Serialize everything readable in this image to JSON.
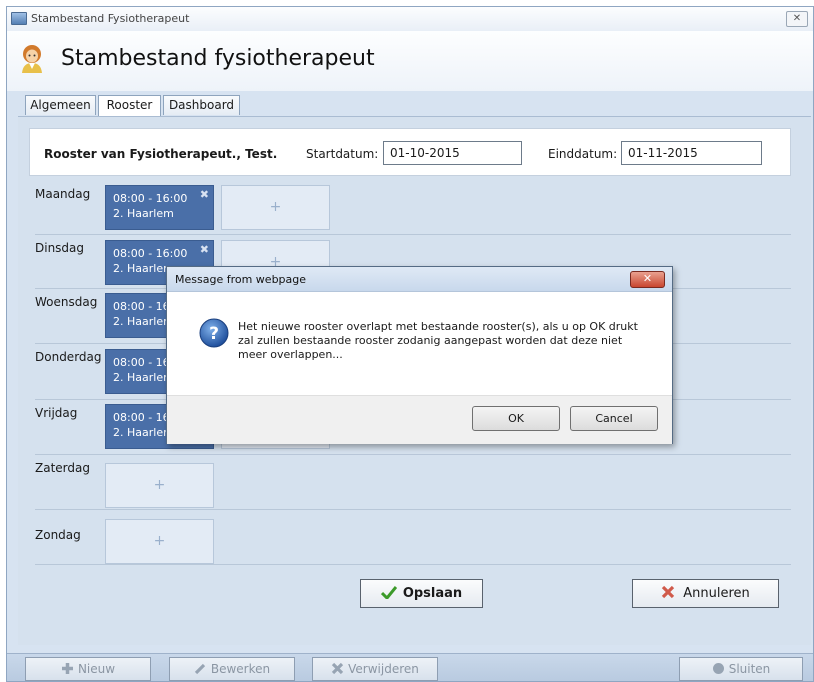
{
  "window": {
    "title": "Stambestand Fysiotherapeut",
    "close_label": "✕"
  },
  "header": {
    "title": "Stambestand fysiotherapeut"
  },
  "tabs": [
    {
      "label": "Algemeen"
    },
    {
      "label": "Rooster"
    },
    {
      "label": "Dashboard"
    }
  ],
  "rooster": {
    "heading": "Rooster van Fysiotherapeut., Test.",
    "start_label": "Startdatum:",
    "start_value": "01-10-2015",
    "end_label": "Einddatum:",
    "end_value": "01-11-2015"
  },
  "days": [
    {
      "name": "Maandag",
      "slot_time": "08:00 - 16:00",
      "slot_location": "2. Haarlem"
    },
    {
      "name": "Dinsdag",
      "slot_time": "08:00 - 16:00",
      "slot_location": "2. Haarlem"
    },
    {
      "name": "Woensdag",
      "slot_time": "08:00 - 16:00",
      "slot_location": "2. Haarlem"
    },
    {
      "name": "Donderdag",
      "slot_time": "08:00 - 16:00",
      "slot_location": "2. Haarlem"
    },
    {
      "name": "Vrijdag",
      "slot_time": "08:00 - 16:00",
      "slot_location": "2. Haarlem"
    },
    {
      "name": "Zaterdag"
    },
    {
      "name": "Zondag"
    }
  ],
  "add_slot_symbol": "+",
  "remove_slot_symbol": "✖",
  "actions": {
    "save_label": "Opslaan",
    "cancel_label": "Annuleren"
  },
  "toolbar": {
    "new_label": "Nieuw",
    "edit_label": "Bewerken",
    "delete_label": "Verwijderen",
    "close_label": "Sluiten"
  },
  "dialog": {
    "title": "Message from webpage",
    "message": "Het nieuwe rooster overlapt met bestaande rooster(s), als u op OK drukt zal zullen bestaande rooster zodanig aangepast worden dat deze niet meer overlappen...",
    "ok_label": "OK",
    "cancel_label": "Cancel",
    "close_label": "✕"
  },
  "icons": {
    "app": "window-app-icon",
    "avatar": "therapist-avatar-icon",
    "question": "question-icon",
    "check": "check-icon",
    "x": "cross-icon",
    "plus": "plus-icon",
    "pencil": "pencil-icon",
    "power": "power-icon"
  },
  "colors": {
    "slot": "#4a6fa8",
    "window_bg": "#d7e3f1",
    "dialog_close": "#c9462f"
  }
}
